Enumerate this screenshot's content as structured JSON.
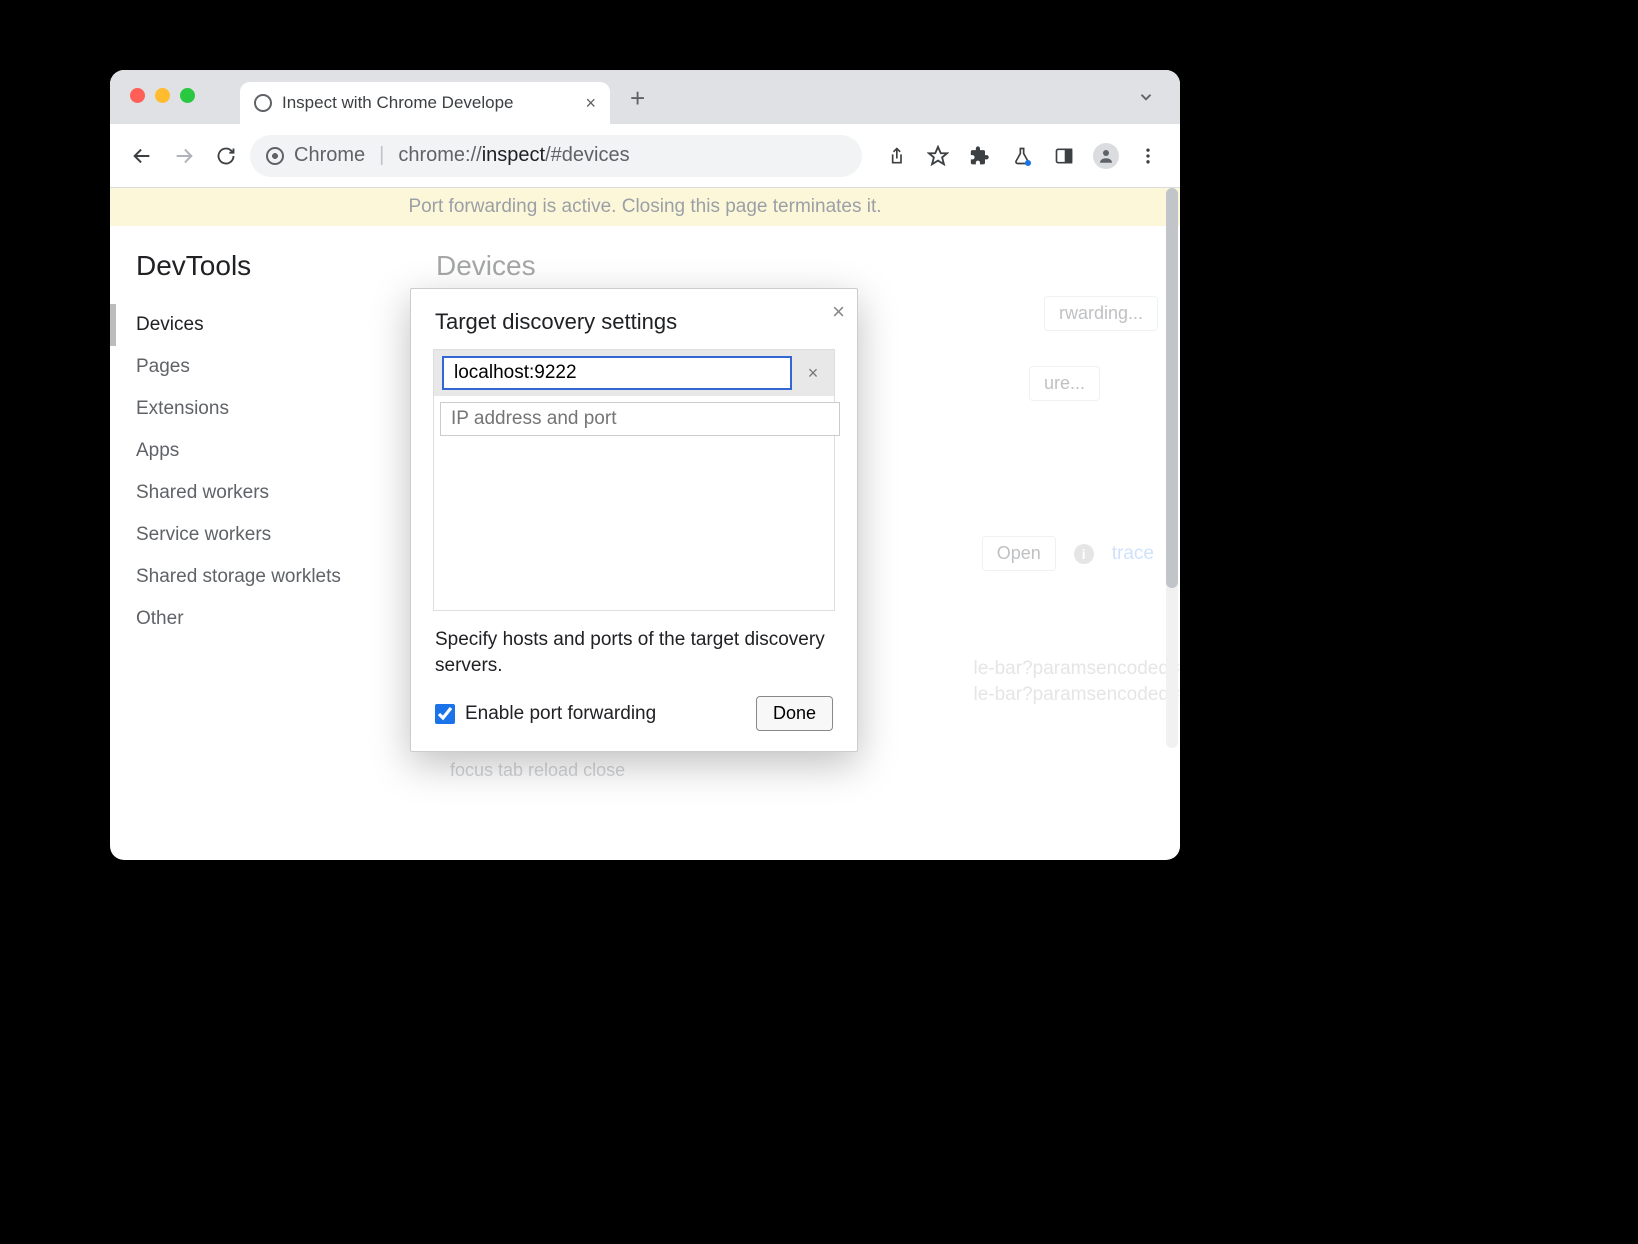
{
  "tab": {
    "title": "Inspect with Chrome Develope"
  },
  "omnibox": {
    "scheme_label": "Chrome",
    "url_prefix": "chrome://",
    "url_highlight": "inspect",
    "url_suffix": "/#devices"
  },
  "banner": {
    "text": "Port forwarding is active. Closing this page terminates it."
  },
  "sidebar": {
    "title": "DevTools",
    "items": [
      {
        "label": "Devices",
        "active": true
      },
      {
        "label": "Pages"
      },
      {
        "label": "Extensions"
      },
      {
        "label": "Apps"
      },
      {
        "label": "Shared workers"
      },
      {
        "label": "Service workers"
      },
      {
        "label": "Shared storage worklets"
      },
      {
        "label": "Other"
      }
    ]
  },
  "main": {
    "heading": "Devices",
    "port_forwarding_btn": "rwarding...",
    "configure_btn": "ure...",
    "open_btn": "Open",
    "trace_link": "trace",
    "params_line1": "le-bar?paramsencoded=",
    "params_line2": "le-bar?paramsencoded=",
    "actions_text": "focus tab    reload    close"
  },
  "modal": {
    "title": "Target discovery settings",
    "target_value": "localhost:9222",
    "placeholder": "IP address and port",
    "hint": "Specify hosts and ports of the target discovery servers.",
    "checkbox_label": "Enable port forwarding",
    "checkbox_checked": true,
    "done_label": "Done"
  }
}
